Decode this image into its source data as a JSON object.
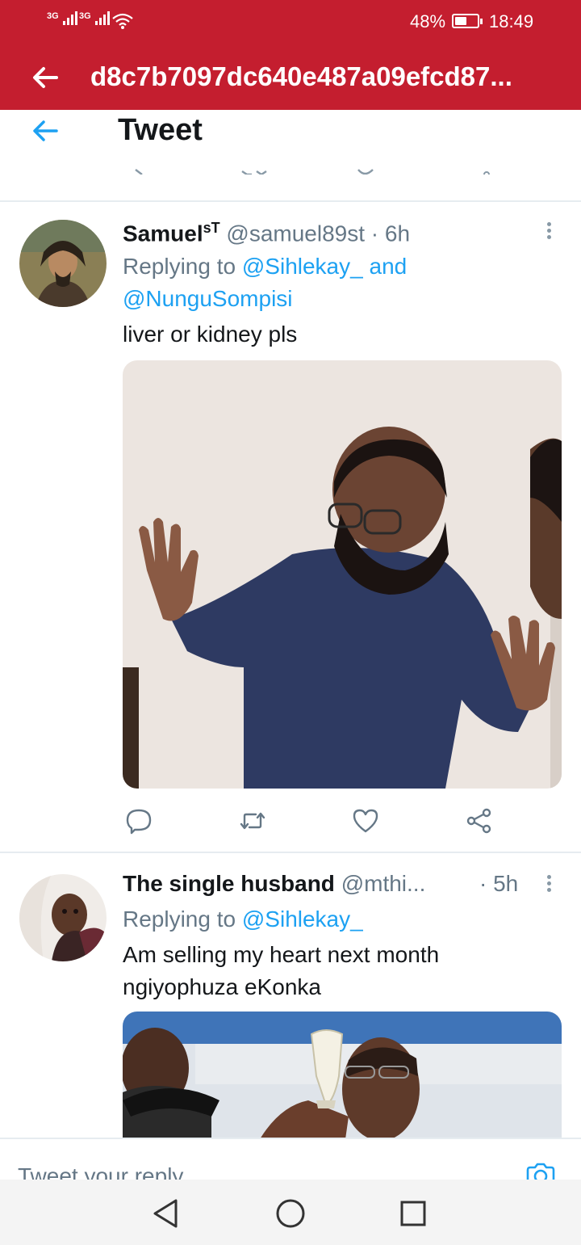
{
  "status_bar": {
    "network_1": "3G",
    "network_2": "3G",
    "battery_text": "48%",
    "battery_level": 0.48,
    "time": "18:49",
    "color": "#c41e2f"
  },
  "app_bar": {
    "title": "d8c7b7097dc640e487a09efcd87..."
  },
  "header": {
    "title": "Tweet"
  },
  "tweets": [
    {
      "name": "Samuel",
      "name_sup": "sT",
      "handle": "@samuel89st",
      "time": "· 6h",
      "replying_prefix": "Replying to",
      "mention_1": "@Sihlekay_",
      "conjunction": "and",
      "mention_2": "@NunguSompisi",
      "text": "liver or kidney pls",
      "media_description_icon": "photo"
    },
    {
      "name": "The single husband",
      "handle": "@mthi...",
      "time": "· 5h",
      "replying_prefix": "Replying to",
      "mention_1": "@Sihlekay_",
      "text_line_1": "Am selling my heart next month",
      "text_line_2": "ngiyophuza eKonka",
      "media_description_icon": "photo"
    }
  ],
  "reply_bar": {
    "placeholder": "Tweet your reply",
    "camera_icon": "camera-icon"
  },
  "nav": {
    "back_icon": "triangle-back-icon",
    "home_icon": "circle-home-icon",
    "recents_icon": "square-recents-icon"
  },
  "colors": {
    "accent": "#1da1f2",
    "brand_red": "#c41e2f",
    "muted": "#657786"
  }
}
